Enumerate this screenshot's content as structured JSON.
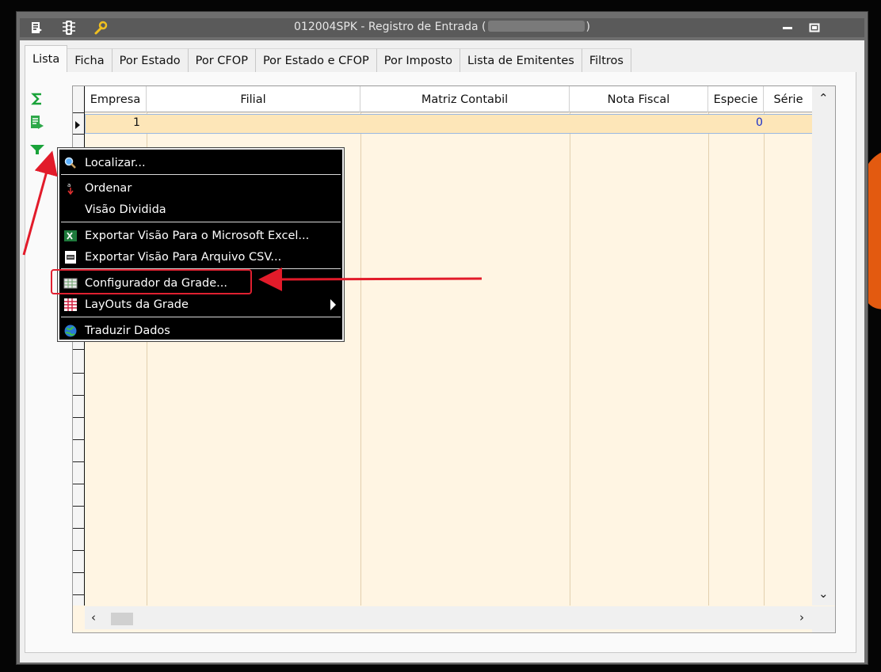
{
  "window": {
    "title_prefix": "012004SPK - Registro de Entrada (",
    "title_suffix": ")"
  },
  "tabs": [
    "Lista",
    "Ficha",
    "Por Estado",
    "Por CFOP",
    "Por Estado e CFOP",
    "Por Imposto",
    "Lista de Emitentes",
    "Filtros"
  ],
  "grid": {
    "columns": [
      "Empresa",
      "Filial",
      "Matriz Contabil",
      "Nota Fiscal",
      "Especie",
      "Série"
    ],
    "rows": [
      {
        "empresa": "1",
        "filial": "",
        "matriz": "",
        "nota": "",
        "especie": "0",
        "serie": ""
      }
    ]
  },
  "context_menu": {
    "items": [
      "Localizar...",
      "Ordenar",
      "Visão Dividida",
      "Exportar Visão Para o Microsoft Excel...",
      "Exportar Visão Para Arquivo CSV...",
      "Configurador da Grade...",
      "LayOuts da Grade",
      "Traduzir Dados"
    ]
  },
  "colors": {
    "grid_bg": "#fff5e3",
    "selected_row": "#fde6b8",
    "highlight": "#e02030",
    "menu_bg": "#000000"
  },
  "icons": [
    "sigma-icon",
    "export-icon",
    "filter-icon",
    "search-icon",
    "sort-icon",
    "excel-icon",
    "csv-icon",
    "grid-config-icon",
    "layout-icon",
    "globe-icon"
  ]
}
